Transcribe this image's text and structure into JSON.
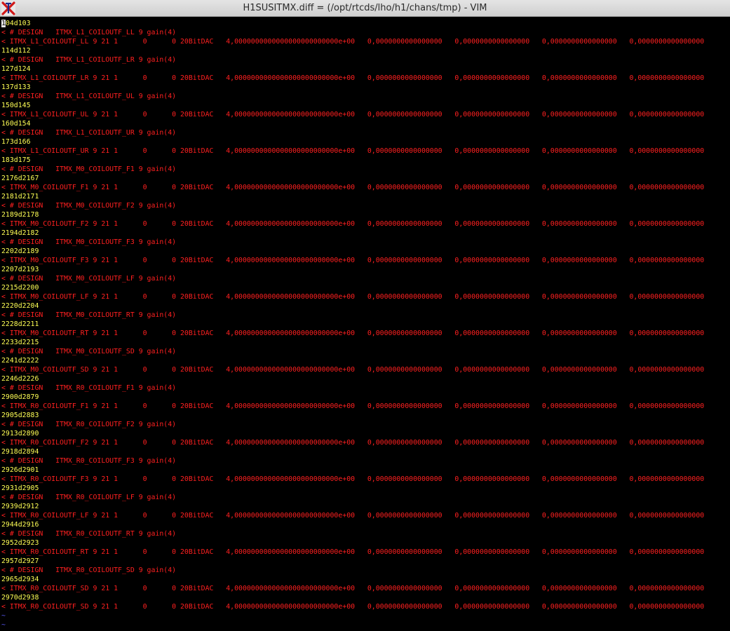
{
  "window": {
    "title": "H1SUSITMX.diff = (/opt/rtcds/lho/h1/chans/tmp) - VIM"
  },
  "diff": {
    "lines": [
      {
        "type": "hunk",
        "text": "104d103"
      },
      {
        "type": "del",
        "text": "< # DESIGN   ITMX_L1_COILOUTF_LL 9 gain(4)"
      },
      {
        "type": "del",
        "text": "< ITMX_L1_COILOUTF_LL 9 21 1      0      0 20BitDAC   4,0000000000000000000000000e+00   0,0000000000000000   0,0000000000000000   0,0000000000000000   0,0000000000000000"
      },
      {
        "type": "hunk",
        "text": "114d112"
      },
      {
        "type": "del",
        "text": "< # DESIGN   ITMX_L1_COILOUTF_LR 9 gain(4)"
      },
      {
        "type": "hunk",
        "text": "127d124"
      },
      {
        "type": "del",
        "text": "< ITMX_L1_COILOUTF_LR 9 21 1      0      0 20BitDAC   4,0000000000000000000000000e+00   0,0000000000000000   0,0000000000000000   0,0000000000000000   0,0000000000000000"
      },
      {
        "type": "hunk",
        "text": "137d133"
      },
      {
        "type": "del",
        "text": "< # DESIGN   ITMX_L1_COILOUTF_UL 9 gain(4)"
      },
      {
        "type": "hunk",
        "text": "150d145"
      },
      {
        "type": "del",
        "text": "< ITMX_L1_COILOUTF_UL 9 21 1      0      0 20BitDAC   4,0000000000000000000000000e+00   0,0000000000000000   0,0000000000000000   0,0000000000000000   0,0000000000000000"
      },
      {
        "type": "hunk",
        "text": "160d154"
      },
      {
        "type": "del",
        "text": "< # DESIGN   ITMX_L1_COILOUTF_UR 9 gain(4)"
      },
      {
        "type": "hunk",
        "text": "173d166"
      },
      {
        "type": "del",
        "text": "< ITMX_L1_COILOUTF_UR 9 21 1      0      0 20BitDAC   4,0000000000000000000000000e+00   0,0000000000000000   0,0000000000000000   0,0000000000000000   0,0000000000000000"
      },
      {
        "type": "hunk",
        "text": "183d175"
      },
      {
        "type": "del",
        "text": "< # DESIGN   ITMX_M0_COILOUTF_F1 9 gain(4)"
      },
      {
        "type": "hunk",
        "text": "2176d2167"
      },
      {
        "type": "del",
        "text": "< ITMX_M0_COILOUTF_F1 9 21 1      0      0 20BitDAC   4,0000000000000000000000000e+00   0,0000000000000000   0,0000000000000000   0,0000000000000000   0,0000000000000000"
      },
      {
        "type": "hunk",
        "text": "2181d2171"
      },
      {
        "type": "del",
        "text": "< # DESIGN   ITMX_M0_COILOUTF_F2 9 gain(4)"
      },
      {
        "type": "hunk",
        "text": "2189d2178"
      },
      {
        "type": "del",
        "text": "< ITMX_M0_COILOUTF_F2 9 21 1      0      0 20BitDAC   4,0000000000000000000000000e+00   0,0000000000000000   0,0000000000000000   0,0000000000000000   0,0000000000000000"
      },
      {
        "type": "hunk",
        "text": "2194d2182"
      },
      {
        "type": "del",
        "text": "< # DESIGN   ITMX_M0_COILOUTF_F3 9 gain(4)"
      },
      {
        "type": "hunk",
        "text": "2202d2189"
      },
      {
        "type": "del",
        "text": "< ITMX_M0_COILOUTF_F3 9 21 1      0      0 20BitDAC   4,0000000000000000000000000e+00   0,0000000000000000   0,0000000000000000   0,0000000000000000   0,0000000000000000"
      },
      {
        "type": "hunk",
        "text": "2207d2193"
      },
      {
        "type": "del",
        "text": "< # DESIGN   ITMX_M0_COILOUTF_LF 9 gain(4)"
      },
      {
        "type": "hunk",
        "text": "2215d2200"
      },
      {
        "type": "del",
        "text": "< ITMX_M0_COILOUTF_LF 9 21 1      0      0 20BitDAC   4,0000000000000000000000000e+00   0,0000000000000000   0,0000000000000000   0,0000000000000000   0,0000000000000000"
      },
      {
        "type": "hunk",
        "text": "2220d2204"
      },
      {
        "type": "del",
        "text": "< # DESIGN   ITMX_M0_COILOUTF_RT 9 gain(4)"
      },
      {
        "type": "hunk",
        "text": "2228d2211"
      },
      {
        "type": "del",
        "text": "< ITMX_M0_COILOUTF_RT 9 21 1      0      0 20BitDAC   4,0000000000000000000000000e+00   0,0000000000000000   0,0000000000000000   0,0000000000000000   0,0000000000000000"
      },
      {
        "type": "hunk",
        "text": "2233d2215"
      },
      {
        "type": "del",
        "text": "< # DESIGN   ITMX_M0_COILOUTF_SD 9 gain(4)"
      },
      {
        "type": "hunk",
        "text": "2241d2222"
      },
      {
        "type": "del",
        "text": "< ITMX_M0_COILOUTF_SD 9 21 1      0      0 20BitDAC   4,0000000000000000000000000e+00   0,0000000000000000   0,0000000000000000   0,0000000000000000   0,0000000000000000"
      },
      {
        "type": "hunk",
        "text": "2246d2226"
      },
      {
        "type": "del",
        "text": "< # DESIGN   ITMX_R0_COILOUTF_F1 9 gain(4)"
      },
      {
        "type": "hunk",
        "text": "2900d2879"
      },
      {
        "type": "del",
        "text": "< ITMX_R0_COILOUTF_F1 9 21 1      0      0 20BitDAC   4,0000000000000000000000000e+00   0,0000000000000000   0,0000000000000000   0,0000000000000000   0,0000000000000000"
      },
      {
        "type": "hunk",
        "text": "2905d2883"
      },
      {
        "type": "del",
        "text": "< # DESIGN   ITMX_R0_COILOUTF_F2 9 gain(4)"
      },
      {
        "type": "hunk",
        "text": "2913d2890"
      },
      {
        "type": "del",
        "text": "< ITMX_R0_COILOUTF_F2 9 21 1      0      0 20BitDAC   4,0000000000000000000000000e+00   0,0000000000000000   0,0000000000000000   0,0000000000000000   0,0000000000000000"
      },
      {
        "type": "hunk",
        "text": "2918d2894"
      },
      {
        "type": "del",
        "text": "< # DESIGN   ITMX_R0_COILOUTF_F3 9 gain(4)"
      },
      {
        "type": "hunk",
        "text": "2926d2901"
      },
      {
        "type": "del",
        "text": "< ITMX_R0_COILOUTF_F3 9 21 1      0      0 20BitDAC   4,0000000000000000000000000e+00   0,0000000000000000   0,0000000000000000   0,0000000000000000   0,0000000000000000"
      },
      {
        "type": "hunk",
        "text": "2931d2905"
      },
      {
        "type": "del",
        "text": "< # DESIGN   ITMX_R0_COILOUTF_LF 9 gain(4)"
      },
      {
        "type": "hunk",
        "text": "2939d2912"
      },
      {
        "type": "del",
        "text": "< ITMX_R0_COILOUTF_LF 9 21 1      0      0 20BitDAC   4,0000000000000000000000000e+00   0,0000000000000000   0,0000000000000000   0,0000000000000000   0,0000000000000000"
      },
      {
        "type": "hunk",
        "text": "2944d2916"
      },
      {
        "type": "del",
        "text": "< # DESIGN   ITMX_R0_COILOUTF_RT 9 gain(4)"
      },
      {
        "type": "hunk",
        "text": "2952d2923"
      },
      {
        "type": "del",
        "text": "< ITMX_R0_COILOUTF_RT 9 21 1      0      0 20BitDAC   4,0000000000000000000000000e+00   0,0000000000000000   0,0000000000000000   0,0000000000000000   0,0000000000000000"
      },
      {
        "type": "hunk",
        "text": "2957d2927"
      },
      {
        "type": "del",
        "text": "< # DESIGN   ITMX_R0_COILOUTF_SD 9 gain(4)"
      },
      {
        "type": "hunk",
        "text": "2965d2934"
      },
      {
        "type": "del",
        "text": "< ITMX_R0_COILOUTF_SD 9 21 1      0      0 20BitDAC   4,0000000000000000000000000e+00   0,0000000000000000   0,0000000000000000   0,0000000000000000   0,0000000000000000"
      },
      {
        "type": "hunk",
        "text": "2970d2938"
      },
      {
        "type": "del",
        "text": "< ITMX_R0_COILOUTF_SD 9 21 1      0      0 20BitDAC   4,0000000000000000000000000e+00   0,0000000000000000   0,0000000000000000   0,0000000000000000   0,0000000000000000"
      }
    ],
    "tildes": [
      "~",
      "~"
    ]
  },
  "colors": {
    "hunk": "#ffff55",
    "deleted": "#ff2020",
    "tilde": "#5c5cff",
    "background": "#000000"
  },
  "icons": {
    "window_icon": "x-app-icon"
  }
}
